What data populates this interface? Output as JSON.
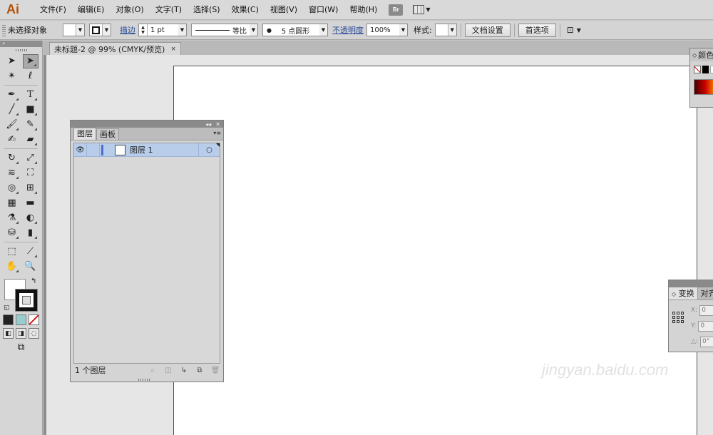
{
  "app": {
    "logo": "Ai",
    "bridge_label": "Br"
  },
  "menu": [
    "文件(F)",
    "编辑(E)",
    "对象(O)",
    "文字(T)",
    "选择(S)",
    "效果(C)",
    "视图(V)",
    "窗口(W)",
    "帮助(H)"
  ],
  "control": {
    "selection_label": "未选择对象",
    "stroke_link": "描边",
    "stroke_weight": "1 pt",
    "profile_label": "等比",
    "brush_label": "5 点圆形",
    "opacity_link": "不透明度",
    "opacity_value": "100%",
    "style_label": "样式:",
    "doc_setup_button": "文档设置",
    "prefs_button": "首选项"
  },
  "document": {
    "tab_title": "未标题-2 @ 99% (CMYK/预览)",
    "close": "×"
  },
  "layers_panel": {
    "tabs": [
      "图层",
      "画板"
    ],
    "layers": [
      {
        "name": "图层 1"
      }
    ],
    "footer_count": "1 个图层"
  },
  "color_panel": {
    "title": "颜色"
  },
  "transform_panel": {
    "tabs": [
      "变换",
      "对齐"
    ],
    "fields": [
      {
        "label": "X:",
        "value": "0"
      },
      {
        "label": "Y:",
        "value": "0"
      },
      {
        "label": "△:",
        "value": "0°"
      }
    ]
  },
  "watermark": "jingyan.baidu.com"
}
